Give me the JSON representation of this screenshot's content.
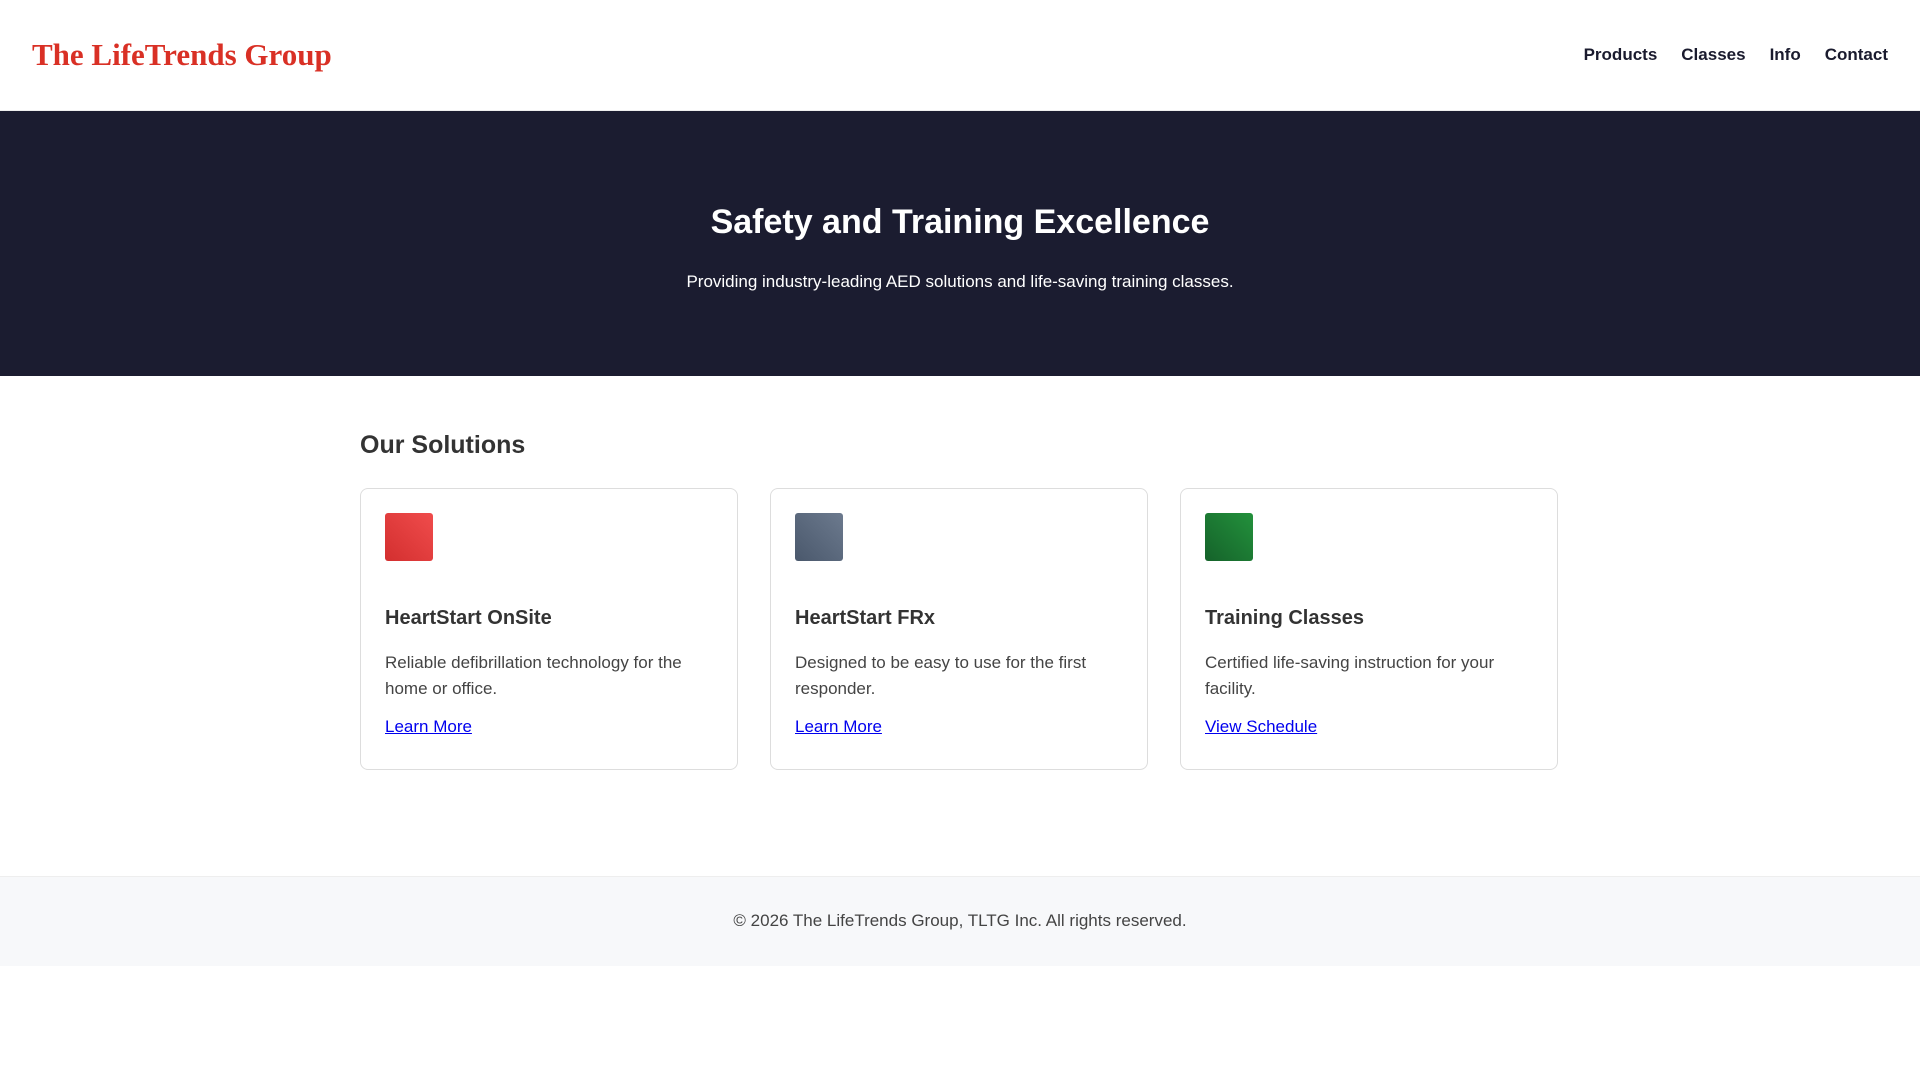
{
  "header": {
    "logo": "The LifeTrends Group",
    "nav": [
      "Products",
      "Classes",
      "Info",
      "Contact"
    ]
  },
  "hero": {
    "title": "Safety and Training Excellence",
    "subtitle": "Providing industry-leading AED solutions and life-saving training classes."
  },
  "solutions": {
    "heading": "Our Solutions",
    "cards": [
      {
        "title": "HeartStart OnSite",
        "description": "Reliable defibrillation technology for the home or office.",
        "link": "Learn More",
        "color": "#e53935"
      },
      {
        "title": "HeartStart FRx",
        "description": "Designed to be easy to use for the first responder.",
        "link": "Learn More",
        "color": "#5a6a80"
      },
      {
        "title": "Training Classes",
        "description": "Certified life-saving instruction for your facility.",
        "link": "View Schedule",
        "color": "#1e7e34"
      }
    ]
  },
  "footer": {
    "text": "© 2026 The LifeTrends Group, TLTG Inc. All rights reserved."
  }
}
